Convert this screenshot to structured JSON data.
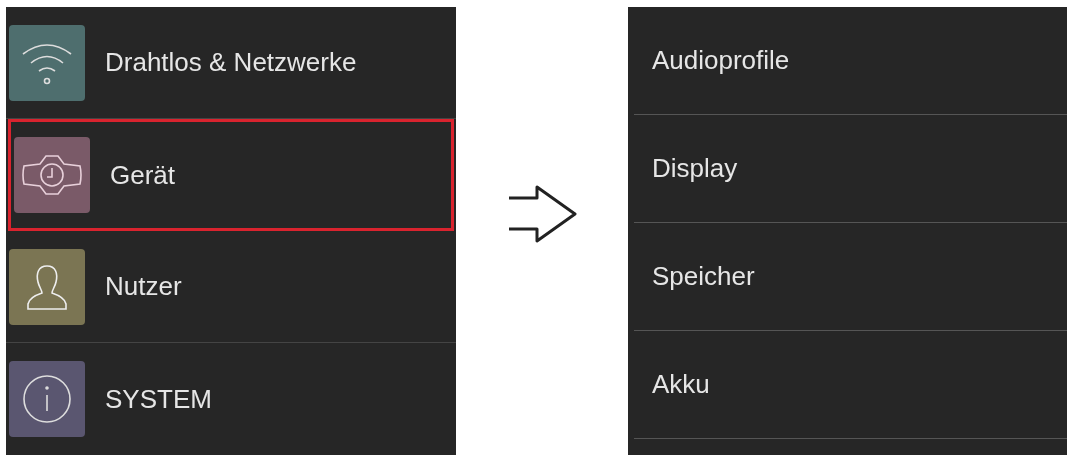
{
  "settings_menu": {
    "items": [
      {
        "kind": "wifi",
        "label": "Drahtlos & Netzwerke",
        "color": "#4e6e6e",
        "selected": false
      },
      {
        "kind": "device",
        "label": "Gerät",
        "color": "#7a5a68",
        "selected": true
      },
      {
        "kind": "user",
        "label": "Nutzer",
        "color": "#7b7553",
        "selected": false
      },
      {
        "kind": "info",
        "label": "SYSTEM",
        "color": "#5a5670",
        "selected": false
      }
    ]
  },
  "device_menu": {
    "items": [
      {
        "label": "Audioprofile"
      },
      {
        "label": "Display"
      },
      {
        "label": "Speicher"
      },
      {
        "label": "Akku"
      }
    ]
  }
}
